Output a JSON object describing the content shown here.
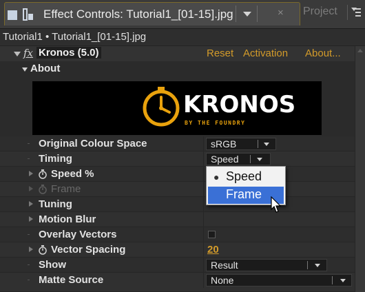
{
  "tab": {
    "title": "Effect Controls: Tutorial1_[01-15].jpg",
    "other_tab": "Project"
  },
  "breadcrumb": "Tutorial1 • Tutorial1_[01-15].jpg",
  "effect": {
    "name": "Kronos (5.0)",
    "links": {
      "reset": "Reset",
      "activation": "Activation",
      "about": "About..."
    }
  },
  "about": {
    "label": "About",
    "logo_text": "KRONOS",
    "logo_sub": "BY THE FOUNDRY",
    "logo_color": "#e9a20d"
  },
  "properties": {
    "original_colour_space": {
      "label": "Original Colour Space",
      "value": "sRGB"
    },
    "timing": {
      "label": "Timing",
      "value": "Speed"
    },
    "speed": {
      "label": "Speed %"
    },
    "frame": {
      "label": "Frame"
    },
    "tuning": {
      "label": "Tuning"
    },
    "motion_blur": {
      "label": "Motion Blur"
    },
    "overlay_vectors": {
      "label": "Overlay Vectors",
      "checked": false
    },
    "vector_spacing": {
      "label": "Vector Spacing",
      "value": "20"
    },
    "show": {
      "label": "Show",
      "value": "Result"
    },
    "matte_source": {
      "label": "Matte Source",
      "value": "None"
    }
  },
  "timing_menu": {
    "options": [
      "Speed",
      "Frame"
    ],
    "checked": "Speed",
    "highlighted": "Frame"
  },
  "colors": {
    "accent_link": "#d39b2a",
    "menu_highlight": "#3a70d6"
  }
}
